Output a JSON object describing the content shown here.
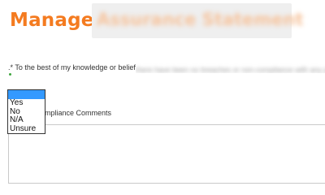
{
  "header": {
    "title": "Manager",
    "title_redacted": "Assurance Statement",
    "title_color": "#f47b20"
  },
  "question": {
    "prefix": ".* To the best of my knowledge or belief",
    "redacted_text": "there have been no breaches or non-compliance with any policy"
  },
  "dropdown": {
    "selected": "",
    "options": [
      "Yes",
      "No",
      "N/A",
      "Unsure"
    ],
    "highlight_color": "#3399ff"
  },
  "comments": {
    "label_visible": "ulatory Compliance Comments",
    "value": ""
  }
}
